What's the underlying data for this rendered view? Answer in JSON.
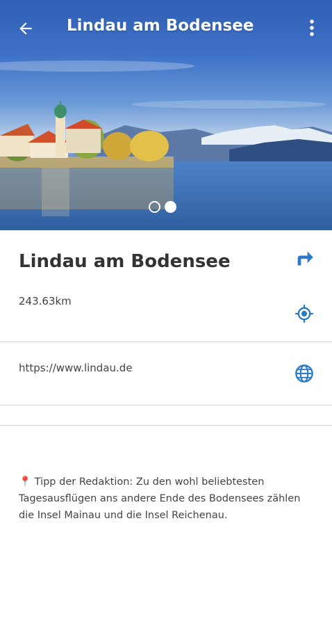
{
  "appbar": {
    "title": "Lindau am Bodensee",
    "back_icon": "arrow-left-icon",
    "menu_icon": "more-vert-icon"
  },
  "gallery": {
    "page_count": 2,
    "active_page": 2
  },
  "details": {
    "name": "Lindau am Bodensee",
    "distance": "243.63km",
    "website": "https://www.lindau.de",
    "tip": "📍 Tipp der Redaktion: Zu den wohl beliebtesten Tagesausflügen ans andere Ende des Bodensees zählen die Insel Mainau und die Insel Reichenau."
  },
  "icons": {
    "directions": "directions-arrow-icon",
    "location": "my-location-icon",
    "web": "globe-icon"
  },
  "colors": {
    "accent": "#2a7ac9",
    "divider": "#d7d7d7",
    "text": "#333333"
  }
}
